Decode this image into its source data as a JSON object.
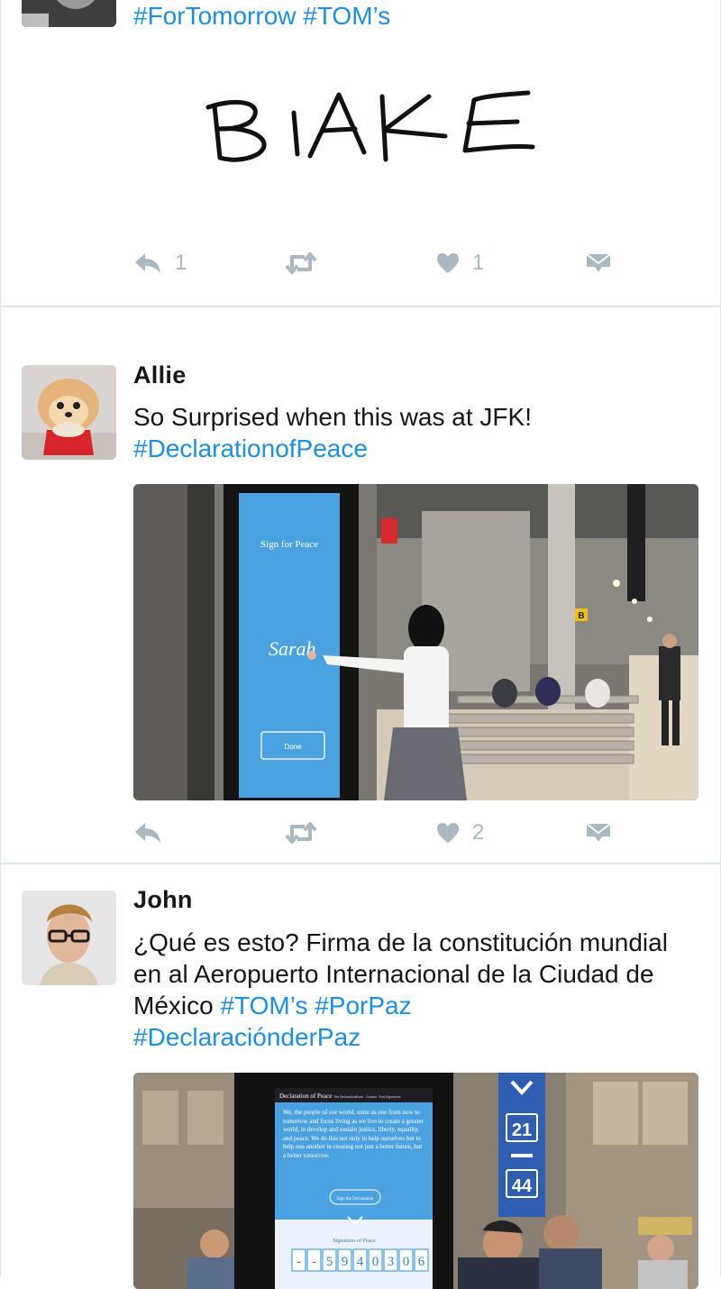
{
  "tweets": [
    {
      "hashtags": "#ForTomorrow #TOM’s",
      "signature": "BIAKE",
      "actions": {
        "reply_count": "1",
        "retweet_count": "",
        "like_count": "1"
      }
    },
    {
      "author": "Allie",
      "text": "So Surprised when this was at JFK!",
      "hashtags": "#DeclarationofPeace",
      "media": {
        "kiosk_title": "Sign for Peace",
        "kiosk_signature": "Sarah",
        "kiosk_button": "Done",
        "gate_sign": "B"
      },
      "actions": {
        "reply_count": "",
        "retweet_count": "",
        "like_count": "2"
      }
    },
    {
      "author": "John",
      "text_plain": "¿Qué es esto? Firma de la constitución mundial en al Aeropuerto Internacional de la Ciudad de México ",
      "hashtags_inline": "#TOM’s #PorPaz",
      "hashtags_next": "#DeclaraciónderPaz",
      "media": {
        "kiosk_header": "Declaration of Peace",
        "kiosk_nav": [
          "The Declaration",
          "About",
          "Contact",
          "Find Signatures"
        ],
        "kiosk_body": "We, the people of our world, unite as one from now to tomorrow and focus living as we live to create a greater world, to develop and sustain justice, liberty, equality, and peace. We do this not only to help ourselves but to help one another in creating not just a better future, but a better tomorrow.",
        "kiosk_button": "Sign the Declaration",
        "signatures_label": "Signatures of Peace",
        "counter_digits": [
          "-",
          "-",
          "5",
          "9",
          "4",
          "0",
          "3",
          "0",
          "6"
        ],
        "platform_number": "21",
        "platform_number_2": "44"
      }
    }
  ],
  "colors": {
    "link": "#1d8fe0",
    "icon": "#aab8c2",
    "divider": "#e1e8ed"
  }
}
